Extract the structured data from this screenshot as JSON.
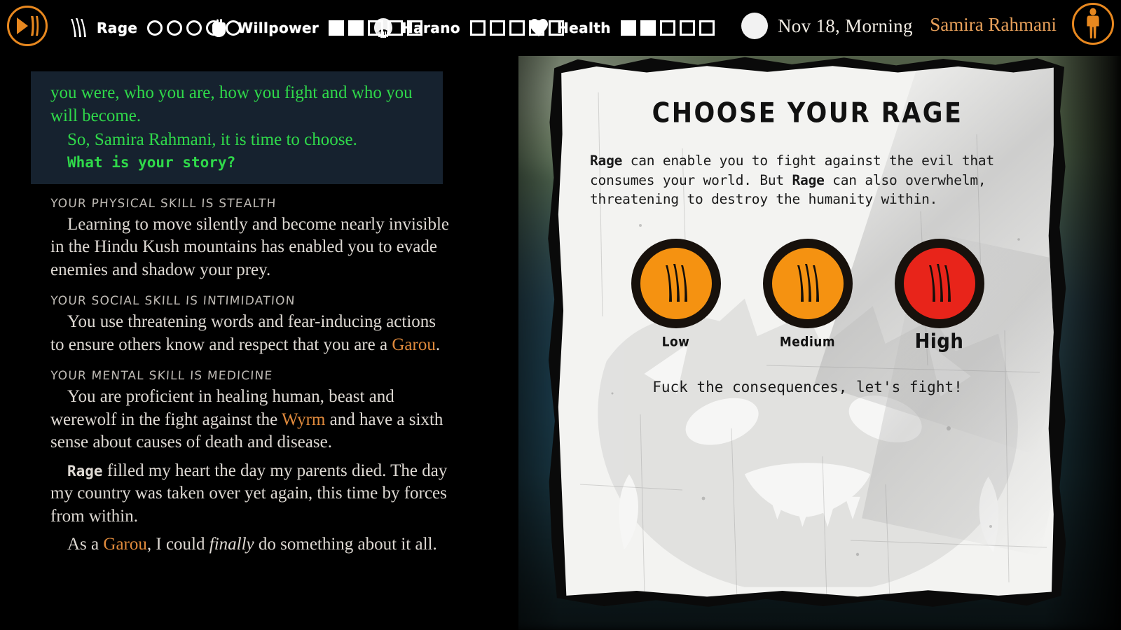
{
  "header": {
    "logo_icon": "play-claw-icon",
    "stats": [
      {
        "icon": "claw-icon",
        "label": "Rage",
        "pip_shape": "circle",
        "total": 5,
        "filled": 0
      },
      {
        "icon": "fist-icon",
        "label": "Willpower",
        "pip_shape": "box",
        "total": 5,
        "filled": 2
      },
      {
        "icon": "skull-icon",
        "label": "Harano",
        "pip_shape": "box",
        "total": 5,
        "filled": 0
      },
      {
        "icon": "heart-icon",
        "label": "Health",
        "pip_shape": "box",
        "total": 5,
        "filled": 2
      }
    ],
    "daytime": {
      "icon": "moon-icon",
      "label": "Nov 18, Morning"
    },
    "character_name": "Samira Rahmani",
    "avatar_icon": "character-silhouette-icon"
  },
  "story": {
    "quote": {
      "line1": "you were, who you are, how you fight and who you will become.",
      "line2": "So, Samira Rahmani, it is time to choose.",
      "line3": "What is your story?"
    },
    "sections": [
      {
        "heading": "YOUR PHYSICAL SKILL IS STEALTH",
        "body": "Learning to move silently and become nearly invisible in the Hindu Kush mountains has enabled you to evade enemies and shadow your prey."
      },
      {
        "heading": "YOUR SOCIAL SKILL IS INTIMIDATION",
        "body_pre": "You use threatening words and fear-inducing actions to ensure others know and respect that you are a ",
        "body_hl": "Garou",
        "body_post": "."
      },
      {
        "heading": "YOUR MENTAL SKILL IS MEDICINE",
        "body_pre": "You are proficient in healing human, beast and werewolf in the fight against the ",
        "body_hl": "Wyrm",
        "body_post": " and have a sixth sense about causes of death and disease."
      }
    ],
    "rage_para": {
      "mono_word": "Rage",
      "rest": " filled my heart the day my parents died. The day my country was taken over yet again, this time by forces from within."
    },
    "final_para": {
      "pre": "As a ",
      "hl": "Garou",
      "mid": ", I could ",
      "ital": "finally",
      "post": " do something about it all."
    }
  },
  "card": {
    "title": "CHOOSE YOUR RAGE",
    "body_1": "Rage",
    "body_2": " can enable you to fight against the evil that consumes your world. But ",
    "body_3": "Rage",
    "body_4": " can also overwhelm, threatening to destroy the humanity within.",
    "options": [
      {
        "label": "Low",
        "color": "#f59211",
        "selected": false
      },
      {
        "label": "Medium",
        "color": "#f59211",
        "selected": false
      },
      {
        "label": "High",
        "color": "#e8241a",
        "selected": true
      }
    ],
    "tagline": "Fuck the consequences, let's fight!"
  },
  "colors": {
    "accent_orange": "#e8881f",
    "text_orange": "#e08a3c",
    "quote_green": "#2fd94a",
    "quote_bg": "#16222f",
    "paper": "#f3f3f1",
    "rage_low": "#f59211",
    "rage_medium": "#f59211",
    "rage_high": "#e8241a"
  }
}
